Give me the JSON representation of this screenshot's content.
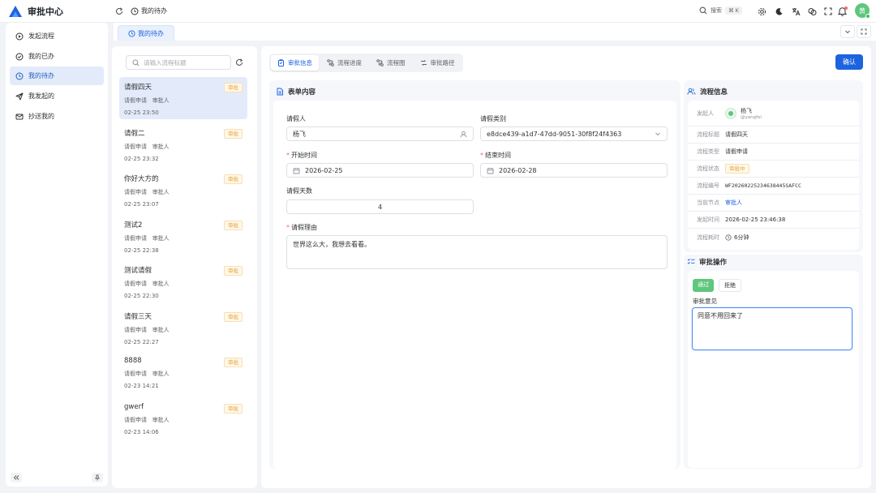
{
  "app": {
    "title": "审批中心",
    "accent": "#1d63e0"
  },
  "header": {
    "breadcrumb": "我的待办",
    "search_label": "搜索",
    "search_shortcut": "⌘ K",
    "avatar_text": "黄"
  },
  "sidebar": {
    "items": [
      {
        "label": "发起流程",
        "icon": "play-circle-icon"
      },
      {
        "label": "我的已办",
        "icon": "check-circle-icon"
      },
      {
        "label": "我的待办",
        "icon": "clock-icon"
      },
      {
        "label": "我发起的",
        "icon": "send-icon"
      },
      {
        "label": "抄送我的",
        "icon": "mail-icon"
      }
    ]
  },
  "tabs": [
    {
      "label": "我的待办"
    }
  ],
  "list": {
    "search_placeholder": "请输入流程标题",
    "items": [
      {
        "title": "请假四天",
        "type": "请假申请",
        "role": "审批人",
        "time": "02-25 23:50",
        "badge": "审批"
      },
      {
        "title": "请假二",
        "type": "请假申请",
        "role": "审批人",
        "time": "02-25 23:32",
        "badge": "审批"
      },
      {
        "title": "你好大方的",
        "type": "请假申请",
        "role": "审批人",
        "time": "02-25 23:07",
        "badge": "审批"
      },
      {
        "title": "测试2",
        "type": "请假申请",
        "role": "审批人",
        "time": "02-25 22:38",
        "badge": "审批"
      },
      {
        "title": "测试请假",
        "type": "请假申请",
        "role": "审批人",
        "time": "02-25 22:30",
        "badge": "审批"
      },
      {
        "title": "请假三天",
        "type": "请假申请",
        "role": "审批人",
        "time": "02-25 22:27",
        "badge": "审批"
      },
      {
        "title": "8888",
        "type": "请假申请",
        "role": "审批人",
        "time": "02-23 14:21",
        "badge": "审批"
      },
      {
        "title": "gwerf",
        "type": "请假申请",
        "role": "审批人",
        "time": "02-23 14:06",
        "badge": "审批"
      }
    ]
  },
  "detail_tabs": [
    {
      "label": "审批信息"
    },
    {
      "label": "流程进度"
    },
    {
      "label": "流程图"
    },
    {
      "label": "审批路径"
    }
  ],
  "confirm_label": "确认",
  "form": {
    "section_title": "表单内容",
    "applicant_label": "请假人",
    "applicant_value": "杨飞",
    "category_label": "请假类别",
    "category_value": "e8dce439-a1d7-47dd-9051-30f8f24f4363",
    "start_label": "开始时间",
    "start_value": "2026-02-25",
    "end_label": "结束时间",
    "end_value": "2026-02-28",
    "days_label": "请假天数",
    "days_value": "4",
    "reason_label": "请假理由",
    "reason_value": "世界这么大，我想去看看。"
  },
  "flow_info": {
    "section_title": "流程信息",
    "initiator_key": "发起人",
    "initiator_name": "杨飞",
    "initiator_handle": "@yangfei",
    "rows": [
      {
        "key": "流程标题",
        "value": "请假四天"
      },
      {
        "key": "流程类型",
        "value": "请假申请"
      },
      {
        "key": "流程状态",
        "value": "审批中"
      },
      {
        "key": "流程编号",
        "value": "WF20260225234638445SAFCC"
      },
      {
        "key": "当前节点",
        "value": "审批人"
      },
      {
        "key": "发起时间",
        "value": "2026-02-25 23:46:38"
      },
      {
        "key": "流程耗时",
        "value": "6分钟"
      }
    ]
  },
  "approval": {
    "section_title": "审批操作",
    "pass_label": "通过",
    "reject_label": "拒绝",
    "opinion_label": "审批意见",
    "opinion_value": "同意不用回来了"
  }
}
